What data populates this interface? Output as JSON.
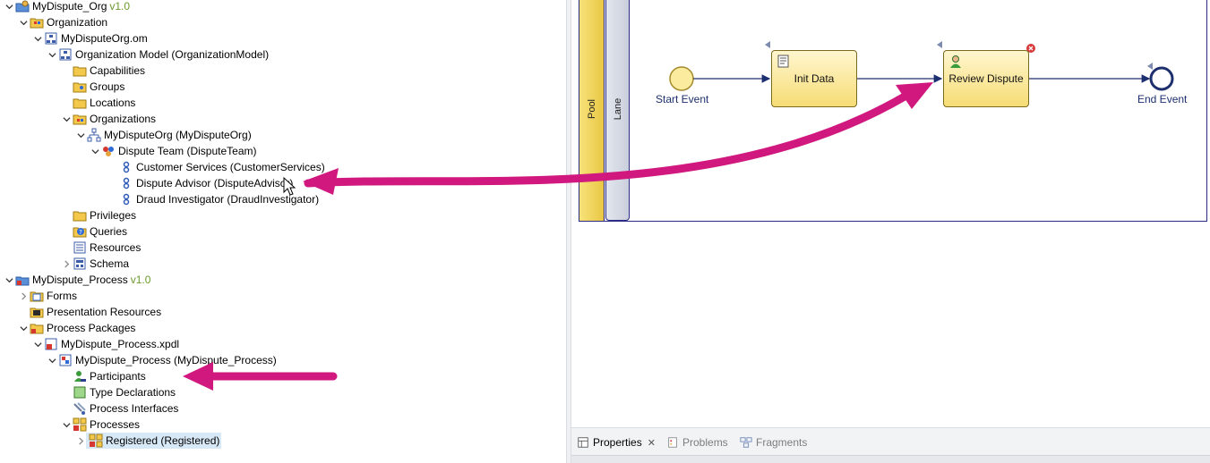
{
  "tree": {
    "items": [
      {
        "label": "MyDispute_Org",
        "version": "v1.0",
        "icon": "org-project-icon"
      },
      {
        "label": "Organization",
        "icon": "organization-folder-icon"
      },
      {
        "label": "MyDisputeOrg.om",
        "icon": "om-file-icon"
      },
      {
        "label": "Organization Model (OrganizationModel)",
        "icon": "org-model-icon"
      },
      {
        "label": "Capabilities",
        "icon": "folder-icon"
      },
      {
        "label": "Groups",
        "icon": "folder-icon"
      },
      {
        "label": "Locations",
        "icon": "folder-icon"
      },
      {
        "label": "Organizations",
        "icon": "folder-icon"
      },
      {
        "label": "MyDisputeOrg (MyDisputeOrg)",
        "icon": "org-structure-icon"
      },
      {
        "label": "Dispute Team (DisputeTeam)",
        "icon": "team-icon"
      },
      {
        "label": "Customer Services (CustomerServices)",
        "icon": "position-icon"
      },
      {
        "label": "Dispute Advisor (DisputeAdvisor)",
        "icon": "position-icon"
      },
      {
        "label": "Draud Investigator (DraudInvestigator)",
        "icon": "position-icon"
      },
      {
        "label": "Privileges",
        "icon": "folder-icon"
      },
      {
        "label": "Queries",
        "icon": "query-folder-icon"
      },
      {
        "label": "Resources",
        "icon": "resources-folder-icon"
      },
      {
        "label": "Schema",
        "icon": "schema-icon"
      },
      {
        "label": "MyDispute_Process",
        "version": "v1.0",
        "icon": "process-project-icon"
      },
      {
        "label": "Forms",
        "icon": "forms-folder-icon"
      },
      {
        "label": "Presentation Resources",
        "icon": "presentation-folder-icon"
      },
      {
        "label": "Process Packages",
        "icon": "process-packages-icon"
      },
      {
        "label": "MyDispute_Process.xpdl",
        "icon": "xpdl-file-icon"
      },
      {
        "label": "MyDispute_Process (MyDispute_Process)",
        "icon": "package-icon"
      },
      {
        "label": "Participants",
        "icon": "participants-icon"
      },
      {
        "label": "Type Declarations",
        "icon": "type-declarations-icon"
      },
      {
        "label": "Process Interfaces",
        "icon": "process-interfaces-icon"
      },
      {
        "label": "Processes",
        "icon": "processes-icon"
      },
      {
        "label": "Registered (Registered)",
        "icon": "process-icon"
      }
    ]
  },
  "diagram": {
    "pool_label": "Pool",
    "lane_label": "Lane",
    "start_event": "Start Event",
    "task_init": "Init Data",
    "task_review": "Review Dispute",
    "end_event": "End Event"
  },
  "properties": {
    "tabs": [
      {
        "label": "Properties",
        "active": true
      },
      {
        "label": "Problems",
        "active": false
      },
      {
        "label": "Fragments",
        "active": false
      }
    ]
  },
  "colors": {
    "accent_arrow": "#d1187e",
    "pool_border": "#2b2b86",
    "task_fill": "#f6dc74",
    "version_green": "#6c9a2d",
    "selection": "#d7e8f7"
  }
}
